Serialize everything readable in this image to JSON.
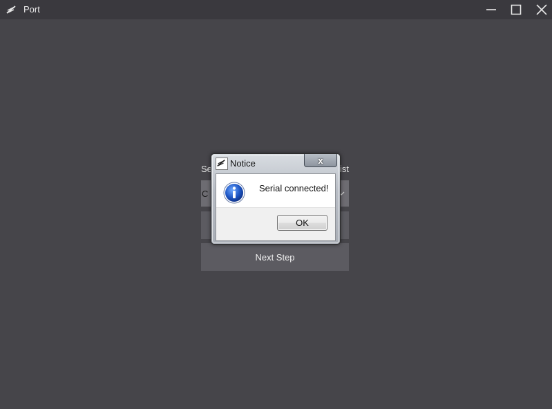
{
  "window": {
    "title": "Port",
    "controls": {
      "minimize": "minimize-icon",
      "maximize": "maximize-icon",
      "close": "close-icon"
    }
  },
  "main": {
    "select_label_start": "Se",
    "select_label_end": "ist",
    "port_select_value": "C",
    "connect_button": "",
    "next_button": "Next Step"
  },
  "dialog": {
    "title": "Notice",
    "close_label": "x",
    "message": "Serial connected!",
    "ok_label": "OK",
    "icon": "info-icon"
  },
  "colors": {
    "background": "#46454a",
    "titlebar": "#3a393e",
    "button": "#5c5b61",
    "info_blue": "#1e56c4"
  }
}
